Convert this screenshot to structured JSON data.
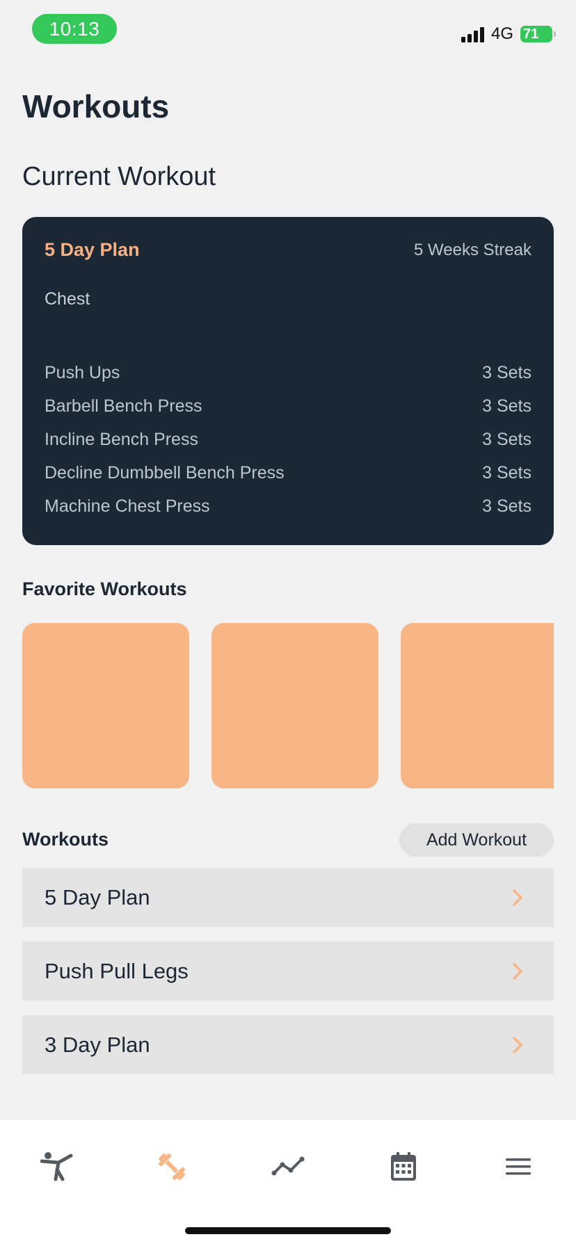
{
  "status_bar": {
    "time": "10:13",
    "network": "4G",
    "battery": "71"
  },
  "page_title": "Workouts",
  "current_section": {
    "title": "Current Workout",
    "card": {
      "plan_name": "5 Day Plan",
      "streak": "5 Weeks Streak",
      "muscle_group": "Chest",
      "exercises": [
        {
          "name": "Push Ups",
          "sets": "3 Sets"
        },
        {
          "name": "Barbell Bench Press",
          "sets": "3 Sets"
        },
        {
          "name": "Incline Bench Press",
          "sets": "3 Sets"
        },
        {
          "name": "Decline Dumbbell Bench Press",
          "sets": "3 Sets"
        },
        {
          "name": "Machine Chest Press",
          "sets": "3 Sets"
        }
      ]
    }
  },
  "favorites": {
    "title": "Favorite Workouts"
  },
  "workouts": {
    "title": "Workouts",
    "add_label": "Add Workout",
    "items": [
      {
        "label": "5 Day Plan"
      },
      {
        "label": "Push Pull Legs"
      },
      {
        "label": "3 Day Plan"
      }
    ]
  },
  "tab_bar": {
    "tabs": [
      {
        "icon": "martial-arts-icon",
        "active": false
      },
      {
        "icon": "dumbbell-icon",
        "active": true
      },
      {
        "icon": "trend-line-icon",
        "active": false
      },
      {
        "icon": "calendar-icon",
        "active": false
      },
      {
        "icon": "menu-icon",
        "active": false
      }
    ]
  },
  "colors": {
    "accent": "#f8b586",
    "card_dark": "#1d2837",
    "status_green": "#34c759",
    "icon_gray": "#555a60"
  }
}
